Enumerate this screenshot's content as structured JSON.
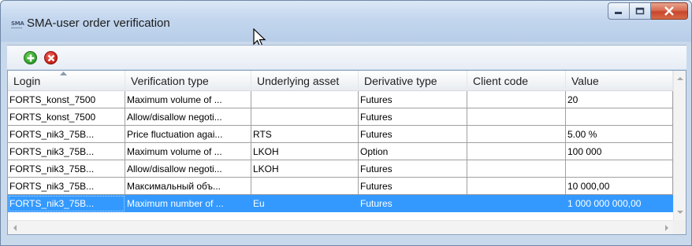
{
  "window": {
    "app_icon_text": "SMA",
    "title": "SMA-user order verification"
  },
  "toolbar": {
    "add_icon": "add-icon",
    "remove_icon": "remove-icon"
  },
  "grid": {
    "columns": [
      "Login",
      "Verification type",
      "Underlying asset",
      "Derivative type",
      "Client code",
      "Value"
    ],
    "sorted_column": "Login",
    "rows": [
      [
        "FORTS_konst_7500",
        "Maximum volume of ...",
        "",
        "Futures",
        "",
        "20"
      ],
      [
        "FORTS_konst_7500",
        "Allow/disallow negoti...",
        "",
        "Futures",
        "",
        ""
      ],
      [
        "FORTS_nik3_75B...",
        "Price fluctuation agai...",
        "RTS",
        "Futures",
        "",
        "5.00 %"
      ],
      [
        "FORTS_nik3_75B...",
        "Maximum volume of ...",
        "LKOH",
        "Option",
        "",
        "100 000"
      ],
      [
        "FORTS_nik3_75B...",
        "Allow/disallow negoti...",
        "LKOH",
        "Futures",
        "",
        ""
      ],
      [
        "FORTS_nik3_75B...",
        "Максимальный объ...",
        "",
        "Futures",
        "",
        "10 000,00"
      ],
      [
        "FORTS_nik3_75B...",
        "Maximum number of ...",
        "Eu",
        "Futures",
        "",
        "1 000 000 000,00"
      ]
    ],
    "selected_row_index": 6
  },
  "colors": {
    "selection": "#3399ff",
    "titlebar": "#c3d6ee",
    "close_button": "#c8452c"
  }
}
